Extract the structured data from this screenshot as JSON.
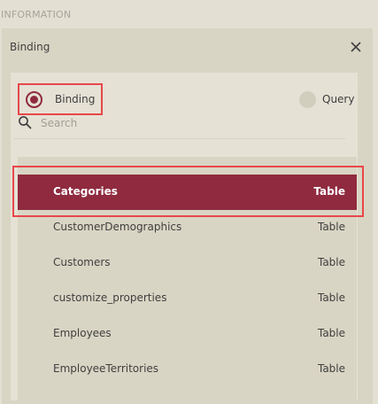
{
  "section": {
    "title": "INFORMATION"
  },
  "panel": {
    "title": "Binding",
    "close_icon": "close-icon"
  },
  "source_mode": {
    "options": [
      {
        "label": "Binding",
        "selected": true
      },
      {
        "label": "Query",
        "selected": false
      }
    ]
  },
  "search": {
    "placeholder": "Search",
    "value": "",
    "icon": "search-icon"
  },
  "items": [
    {
      "name": "Categories",
      "type": "Table",
      "selected": true
    },
    {
      "name": "CustomerDemographics",
      "type": "Table",
      "selected": false
    },
    {
      "name": "Customers",
      "type": "Table",
      "selected": false
    },
    {
      "name": "customize_properties",
      "type": "Table",
      "selected": false
    },
    {
      "name": "Employees",
      "type": "Table",
      "selected": false
    },
    {
      "name": "EmployeeTerritories",
      "type": "Table",
      "selected": false
    }
  ],
  "colors": {
    "accent": "#8f2a3f",
    "highlight_border": "#e8474a",
    "background": "#e3dfd3",
    "panel_background": "#d9d5c4"
  }
}
